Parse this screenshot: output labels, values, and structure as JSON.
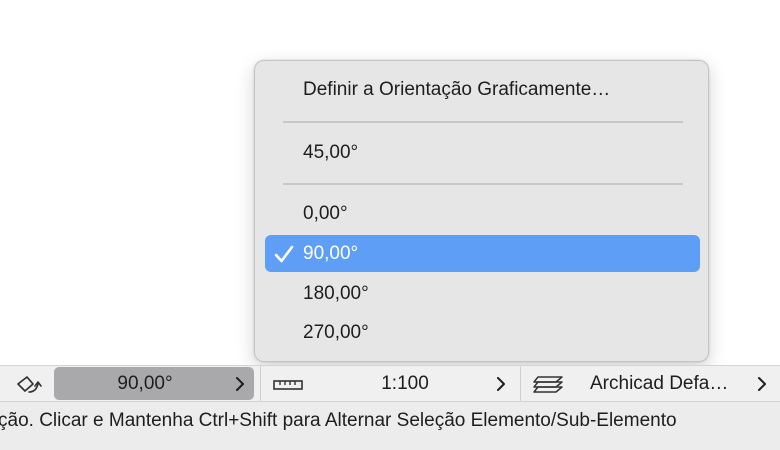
{
  "menu": {
    "items": [
      {
        "label": "Definir a Orientação Graficamente…",
        "selected": false
      },
      {
        "label": "45,00°",
        "selected": false
      },
      {
        "label": "0,00°",
        "selected": false
      },
      {
        "label": "90,00°",
        "selected": true
      },
      {
        "label": "180,00°",
        "selected": false
      },
      {
        "label": "270,00°",
        "selected": false
      }
    ],
    "selection_color": "#5f9ef7",
    "checkmark_icon": "checkmark-icon"
  },
  "toolbar": {
    "orientation_icon": "orientation-icon",
    "orientation_value": "90,00°",
    "scale_icon": "ruler-icon",
    "scale_value": "1:100",
    "layers_icon": "layers-icon",
    "layer_combination": "Archicad Defa…"
  },
  "status": {
    "text": "ção. Clicar e Mantenha Ctrl+Shift para Alternar Seleção Elemento/Sub-Elemento"
  }
}
